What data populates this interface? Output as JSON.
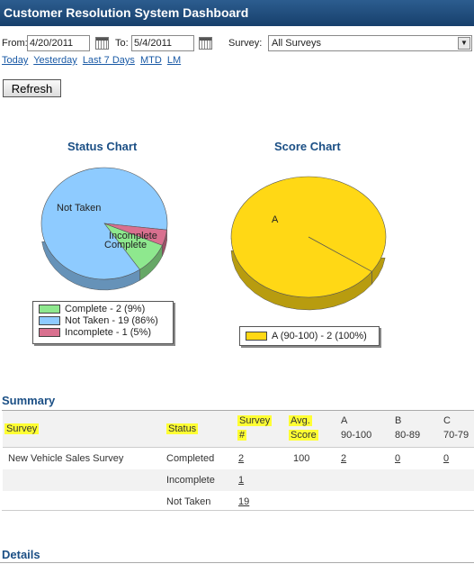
{
  "header": {
    "title": "Customer Resolution System Dashboard"
  },
  "filters": {
    "from_label": "From:",
    "from_value": "4/20/2011",
    "to_label": "To:",
    "to_value": "5/4/2011",
    "survey_label": "Survey:",
    "survey_value": "All Surveys",
    "quick_links": [
      "Today",
      "Yesterday",
      "Last 7 Days",
      "MTD",
      "LM"
    ],
    "refresh_label": "Refresh"
  },
  "status_chart": {
    "title": "Status Chart",
    "labels": {
      "not_taken": "Not Taken",
      "incomplete": "Incomplete",
      "complete": "Complete"
    },
    "legend": [
      "Complete - 2 (9%)",
      "Not Taken - 19 (86%)",
      "Incomplete - 1 (5%)"
    ],
    "colors": {
      "complete": "#8ee88e",
      "not_taken": "#8ecbff",
      "incomplete": "#d9708f"
    }
  },
  "score_chart": {
    "title": "Score Chart",
    "label": "A",
    "legend": [
      "A (90-100) - 2 (100%)"
    ],
    "colors": {
      "a": "#ffd815"
    }
  },
  "chart_data": [
    {
      "type": "pie",
      "title": "Status Chart",
      "categories": [
        "Complete",
        "Not Taken",
        "Incomplete"
      ],
      "values": [
        2,
        19,
        1
      ],
      "legend": [
        "Complete - 2 (9%)",
        "Not Taken - 19 (86%)",
        "Incomplete - 1 (5%)"
      ]
    },
    {
      "type": "pie",
      "title": "Score Chart",
      "categories": [
        "A"
      ],
      "values": [
        2
      ],
      "legend": [
        "A (90-100) - 2 (100%)"
      ]
    }
  ],
  "summary": {
    "title": "Summary",
    "headers": {
      "survey": "Survey",
      "status": "Status",
      "survey_num_1": "Survey",
      "survey_num_2": "#",
      "avg_1": "Avg.",
      "avg_2": "Score",
      "a_1": "A",
      "a_2": "90-100",
      "b_1": "B",
      "b_2": "80-89",
      "c_1": "C",
      "c_2": "70-79"
    },
    "rows": [
      {
        "survey": "New Vehicle Sales Survey",
        "status": "Completed",
        "count": "2",
        "avg": "100",
        "a": "2",
        "b": "0",
        "c": "0"
      },
      {
        "survey": "",
        "status": "Incomplete",
        "count": "1",
        "avg": "",
        "a": "",
        "b": "",
        "c": ""
      },
      {
        "survey": "",
        "status": "Not Taken",
        "count": "19",
        "avg": "",
        "a": "",
        "b": "",
        "c": ""
      }
    ]
  },
  "details": {
    "title": "Details"
  }
}
